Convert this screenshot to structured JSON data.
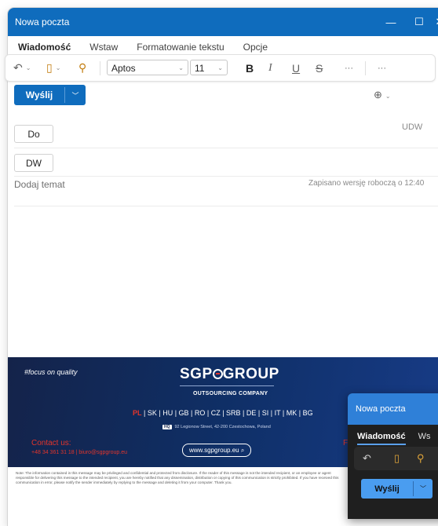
{
  "window": {
    "title": "Nowa poczta"
  },
  "tabs": [
    "Wiadomość",
    "Wstaw",
    "Formatowanie tekstu",
    "Opcje"
  ],
  "ribbon": {
    "font": "Aptos",
    "size": "11",
    "bold": "B",
    "italic": "I",
    "underline": "U",
    "strike": "S",
    "more1": "···",
    "more2": "···"
  },
  "send": {
    "label": "Wyślij"
  },
  "recipients": {
    "to": "Do",
    "cc": "DW",
    "bcc": "UDW"
  },
  "subject": {
    "placeholder": "Dodaj temat",
    "status": "Zapisano wersję roboczą o 12:40"
  },
  "signature": {
    "tagline": "#focus on quality",
    "logo": {
      "pre": "SGP",
      "post": "GROUP"
    },
    "subtitle": "OUTSOURCING COMPANY",
    "countries_first": "PL",
    "countries_rest": " | SK | HU | GB | RO | CZ | SRB | DE | SI | IT | MK | BG",
    "hq_badge": "HQ",
    "address": "92 Legionow Street, 42-200 Czestochowa, Poland",
    "contact_heading": "Contact us:",
    "contact_line": "+48 34 361 31 18  |  biuro@sgpgroup.eu",
    "website": "www.sgpgroup.eu",
    "right_heading": "F"
  },
  "disclaimer": "Note: The information contained in this message may be privileged and confidential and protected from disclosure. If the reader of this message is not the intended recipient, or an employee or agent responsible for delivering this message to the intended recipient, you are hereby notified that any dissemination, distribution or copying of this communication is strictly prohibited. If you have received this communication in error, please notify the sender immediately by replying to the message and deleting it from your computer. Thank you.",
  "mini_window": {
    "title": "Nowa poczta",
    "tabs": [
      "Wiadomość",
      "Ws"
    ],
    "send_label": "Wyślij"
  },
  "colors": {
    "accent": "#0f6cbd",
    "signature_bg": "#14234a",
    "signature_red": "#e3352b"
  }
}
